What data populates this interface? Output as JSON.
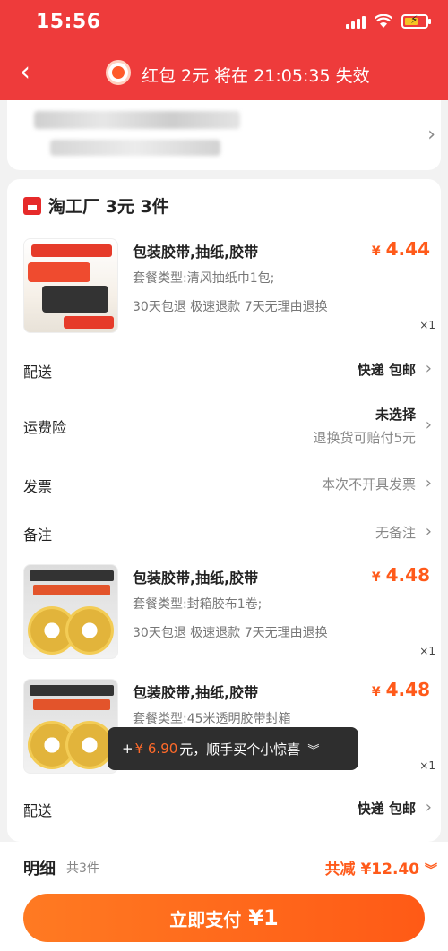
{
  "status_bar": {
    "time": "15:56"
  },
  "header": {
    "countdown_text": "红包 2元 将在 21:05:35 失效"
  },
  "store": {
    "name": "淘工厂 3元 3件"
  },
  "items": [
    {
      "title": "包装胶带,抽纸,胶带",
      "spec": "套餐类型:清风抽纸巾1包;",
      "tags": "30天包退  极速退款  7天无理由退换",
      "price_symbol": "¥",
      "price": "4.44",
      "qty": "×1"
    },
    {
      "title": "包装胶带,抽纸,胶带",
      "spec": "套餐类型:封箱胶布1卷;",
      "tags": "30天包退  极速退款  7天无理由退换",
      "price_symbol": "¥",
      "price": "4.48",
      "qty": "×1"
    },
    {
      "title": "包装胶带,抽纸,胶带",
      "spec": "套餐类型:45米透明胶带封箱",
      "tags": "",
      "price_symbol": "¥",
      "price": "4.48",
      "qty": "×1"
    }
  ],
  "rows": {
    "delivery1_label": "配送",
    "delivery1_value": "快递 包邮",
    "insurance_label": "运费险",
    "insurance_value": "未选择",
    "insurance_sub": "退换货可赔付5元",
    "invoice_label": "发票",
    "invoice_value": "本次不开具发票",
    "note_label": "备注",
    "note_value": "无备注",
    "delivery2_label": "配送",
    "delivery2_value": "快递 包邮"
  },
  "toast": {
    "prefix": "+",
    "amount": "¥ 6.90",
    "suffix": "元，顺手买个小惊喜"
  },
  "summary": {
    "detail_label": "明细",
    "detail_count": "共3件",
    "discount_text": "共减 ¥12.40",
    "pay_label": "立即支付",
    "pay_amount": "¥1"
  },
  "colors": {
    "header_red": "#ee3b3b",
    "accent_orange": "#ff5a1a"
  }
}
